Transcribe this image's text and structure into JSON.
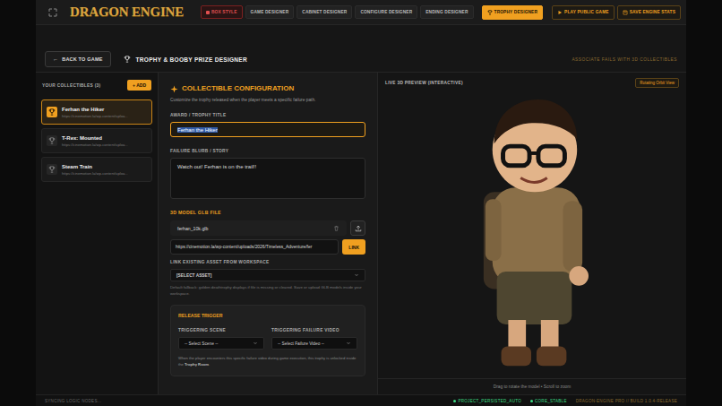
{
  "header": {
    "logo": "DRAGON ENGINE",
    "nav": [
      {
        "label": "BOX STYLE",
        "kind": "box",
        "selected": false
      },
      {
        "label": "GAME DESIGNER",
        "kind": "tab",
        "selected": false
      },
      {
        "label": "CABINET DESIGNER",
        "kind": "tab",
        "selected": false
      },
      {
        "label": "CONFIGURE DESIGNER",
        "kind": "tab",
        "selected": false
      },
      {
        "label": "ENDING DESIGNER",
        "kind": "tab",
        "selected": false
      },
      {
        "label": "TROPHY DESIGNER",
        "kind": "tab",
        "selected": true
      }
    ],
    "actions": [
      {
        "label": "PLAY PUBLIC GAME",
        "kind": "play"
      },
      {
        "label": "SAVE ENGINE STATS",
        "kind": "save"
      }
    ]
  },
  "subheader": {
    "back_arrow": "←",
    "back_label": "BACK TO GAME",
    "title": "TROPHY & BOOBY PRIZE DESIGNER",
    "tagline": "ASSOCIATE FAILS WITH 3D COLLECTIBLES"
  },
  "sidebar": {
    "title": "YOUR COLLECTIBLES (3)",
    "add_button": "+ ADD",
    "items": [
      {
        "title": "Ferhan the Hiker",
        "url": "https://cinemotion.la/wp-content/uploa...",
        "selected": true
      },
      {
        "title": "T-Rex: Mounted",
        "url": "https://cinemotion.la/wp-content/uploa...",
        "selected": false
      },
      {
        "title": "Steam Train",
        "url": "https://cinemotion.la/wp-content/uploa...",
        "selected": false
      }
    ]
  },
  "form": {
    "heading": "COLLECTIBLE CONFIGURATION",
    "subtitle": "Customize the trophy released when the player meets a specific failure path.",
    "title_label": "AWARD / TROPHY TITLE",
    "title_value": "Ferhan the Hiker",
    "title_text_selected": true,
    "blurb_label": "FAILURE BLURB / STORY",
    "blurb_value": "Watch out! Ferhan is on the trail!!",
    "model_label": "3D MODEL GLB FILE",
    "file_name": "ferhan_10k.glb",
    "url_value": "https://cinemotion.la/wp-content/uploads/2026/Timeless_Adventure/fer",
    "link_button": "LINK",
    "workspace_label": "LINK EXISTING ASSET FROM WORKSPACE",
    "workspace_value": "[SELECT ASSET]",
    "hint": "Default fallback: golden deathtrophy displays if file is missing or cleared. Save or upload GLB models inside your workspace."
  },
  "trigger": {
    "heading": "RELEASE TRIGGER",
    "scene_label": "TRIGGERING SCENE",
    "scene_value": "-- Select Scene --",
    "video_label": "TRIGGERING FAILURE VIDEO",
    "video_value": "-- Select Failure Video --",
    "note_before": "When the player encounters this specific failure video during game execution, this trophy is unlocked inside the ",
    "note_bold": "Trophy Room",
    "note_after": "."
  },
  "preview": {
    "label": "LIVE 3D PREVIEW (INTERACTIVE)",
    "badge": "Rotating Orbit View",
    "footer": "Drag to rotate the model • Scroll to zoom"
  },
  "status_bar": {
    "left": "SYNCING LOGIC NODES...",
    "items": [
      {
        "label": "PROJECT_PERSISTED_AUTO",
        "color": "#3ddc84"
      },
      {
        "label": "CORE_STABLE",
        "color": "#3ddc84"
      }
    ],
    "build": "DRAGON-ENGINE PRO // BUILD 1.0.4-RELEASE"
  }
}
